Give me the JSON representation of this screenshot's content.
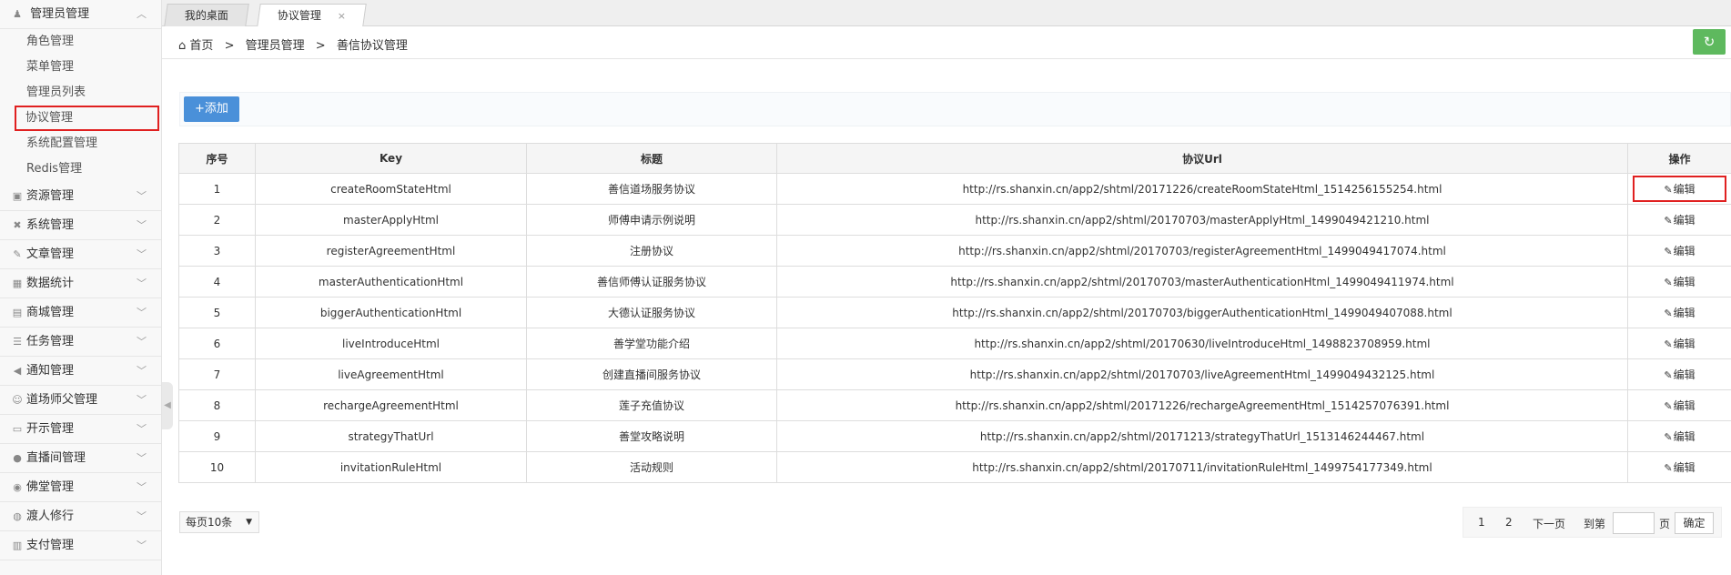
{
  "tabs": [
    {
      "label": "我的桌面"
    },
    {
      "label": "协议管理",
      "close": "×"
    }
  ],
  "breadcrumb": {
    "home": "首页",
    "sep1": ">",
    "level1": "管理员管理",
    "sep2": ">",
    "level2": "善信协议管理"
  },
  "refresh_icon": "↻",
  "sidebar": {
    "admin_group": "管理员管理",
    "admin_items": [
      "角色管理",
      "菜单管理",
      "管理员列表",
      "协议管理",
      "系统配置管理",
      "Redis管理"
    ],
    "groups": [
      "资源管理",
      "系统管理",
      "文章管理",
      "数据统计",
      "商城管理",
      "任务管理",
      "通知管理",
      "道场师父管理",
      "开示管理",
      "直播间管理",
      "佛堂管理",
      "渡人修行",
      "支付管理"
    ],
    "icons": [
      "▣",
      "✖",
      "✎",
      "▦",
      "▤",
      "☰",
      "◀",
      "☺",
      "▭",
      "●",
      "◉",
      "◍",
      "▥"
    ],
    "chevron_up": "︿",
    "chevron_down": "﹀",
    "admin_icon": "♟",
    "collapse_arrow": "◀"
  },
  "toolbar": {
    "add_label": "+添加"
  },
  "table": {
    "headers": [
      "序号",
      "Key",
      "标题",
      "协议Url",
      "操作"
    ],
    "edit_label": "编辑",
    "edit_icon": "✎",
    "rows": [
      {
        "no": "1",
        "key": "createRoomStateHtml",
        "title": "善信道场服务协议",
        "url": "http://rs.shanxin.cn/app2/shtml/20171226/createRoomStateHtml_1514256155254.html"
      },
      {
        "no": "2",
        "key": "masterApplyHtml",
        "title": "师傅申请示例说明",
        "url": "http://rs.shanxin.cn/app2/shtml/20170703/masterApplyHtml_1499049421210.html"
      },
      {
        "no": "3",
        "key": "registerAgreementHtml",
        "title": "注册协议",
        "url": "http://rs.shanxin.cn/app2/shtml/20170703/registerAgreementHtml_1499049417074.html"
      },
      {
        "no": "4",
        "key": "masterAuthenticationHtml",
        "title": "善信师傅认证服务协议",
        "url": "http://rs.shanxin.cn/app2/shtml/20170703/masterAuthenticationHtml_1499049411974.html"
      },
      {
        "no": "5",
        "key": "biggerAuthenticationHtml",
        "title": "大德认证服务协议",
        "url": "http://rs.shanxin.cn/app2/shtml/20170703/biggerAuthenticationHtml_1499049407088.html"
      },
      {
        "no": "6",
        "key": "liveIntroduceHtml",
        "title": "善学堂功能介绍",
        "url": "http://rs.shanxin.cn/app2/shtml/20170630/liveIntroduceHtml_1498823708959.html"
      },
      {
        "no": "7",
        "key": "liveAgreementHtml",
        "title": "创建直播间服务协议",
        "url": "http://rs.shanxin.cn/app2/shtml/20170703/liveAgreementHtml_1499049432125.html"
      },
      {
        "no": "8",
        "key": "rechargeAgreementHtml",
        "title": "莲子充值协议",
        "url": "http://rs.shanxin.cn/app2/shtml/20171226/rechargeAgreementHtml_1514257076391.html"
      },
      {
        "no": "9",
        "key": "strategyThatUrl",
        "title": "善堂攻略说明",
        "url": "http://rs.shanxin.cn/app2/shtml/20171213/strategyThatUrl_1513146244467.html"
      },
      {
        "no": "10",
        "key": "invitationRuleHtml",
        "title": "活动规则",
        "url": "http://rs.shanxin.cn/app2/shtml/20170711/invitationRuleHtml_1499754177349.html"
      }
    ]
  },
  "footer": {
    "page_size": "每页10条",
    "page_size_arrow": "▼",
    "pages": [
      "1",
      "2"
    ],
    "next": "下一页",
    "goto_prefix": "到第",
    "goto_suffix": "页",
    "confirm": "确定"
  },
  "colors": {
    "accent": "#4a90d9",
    "refresh": "#5eb95e",
    "highlight": "#e02020"
  }
}
